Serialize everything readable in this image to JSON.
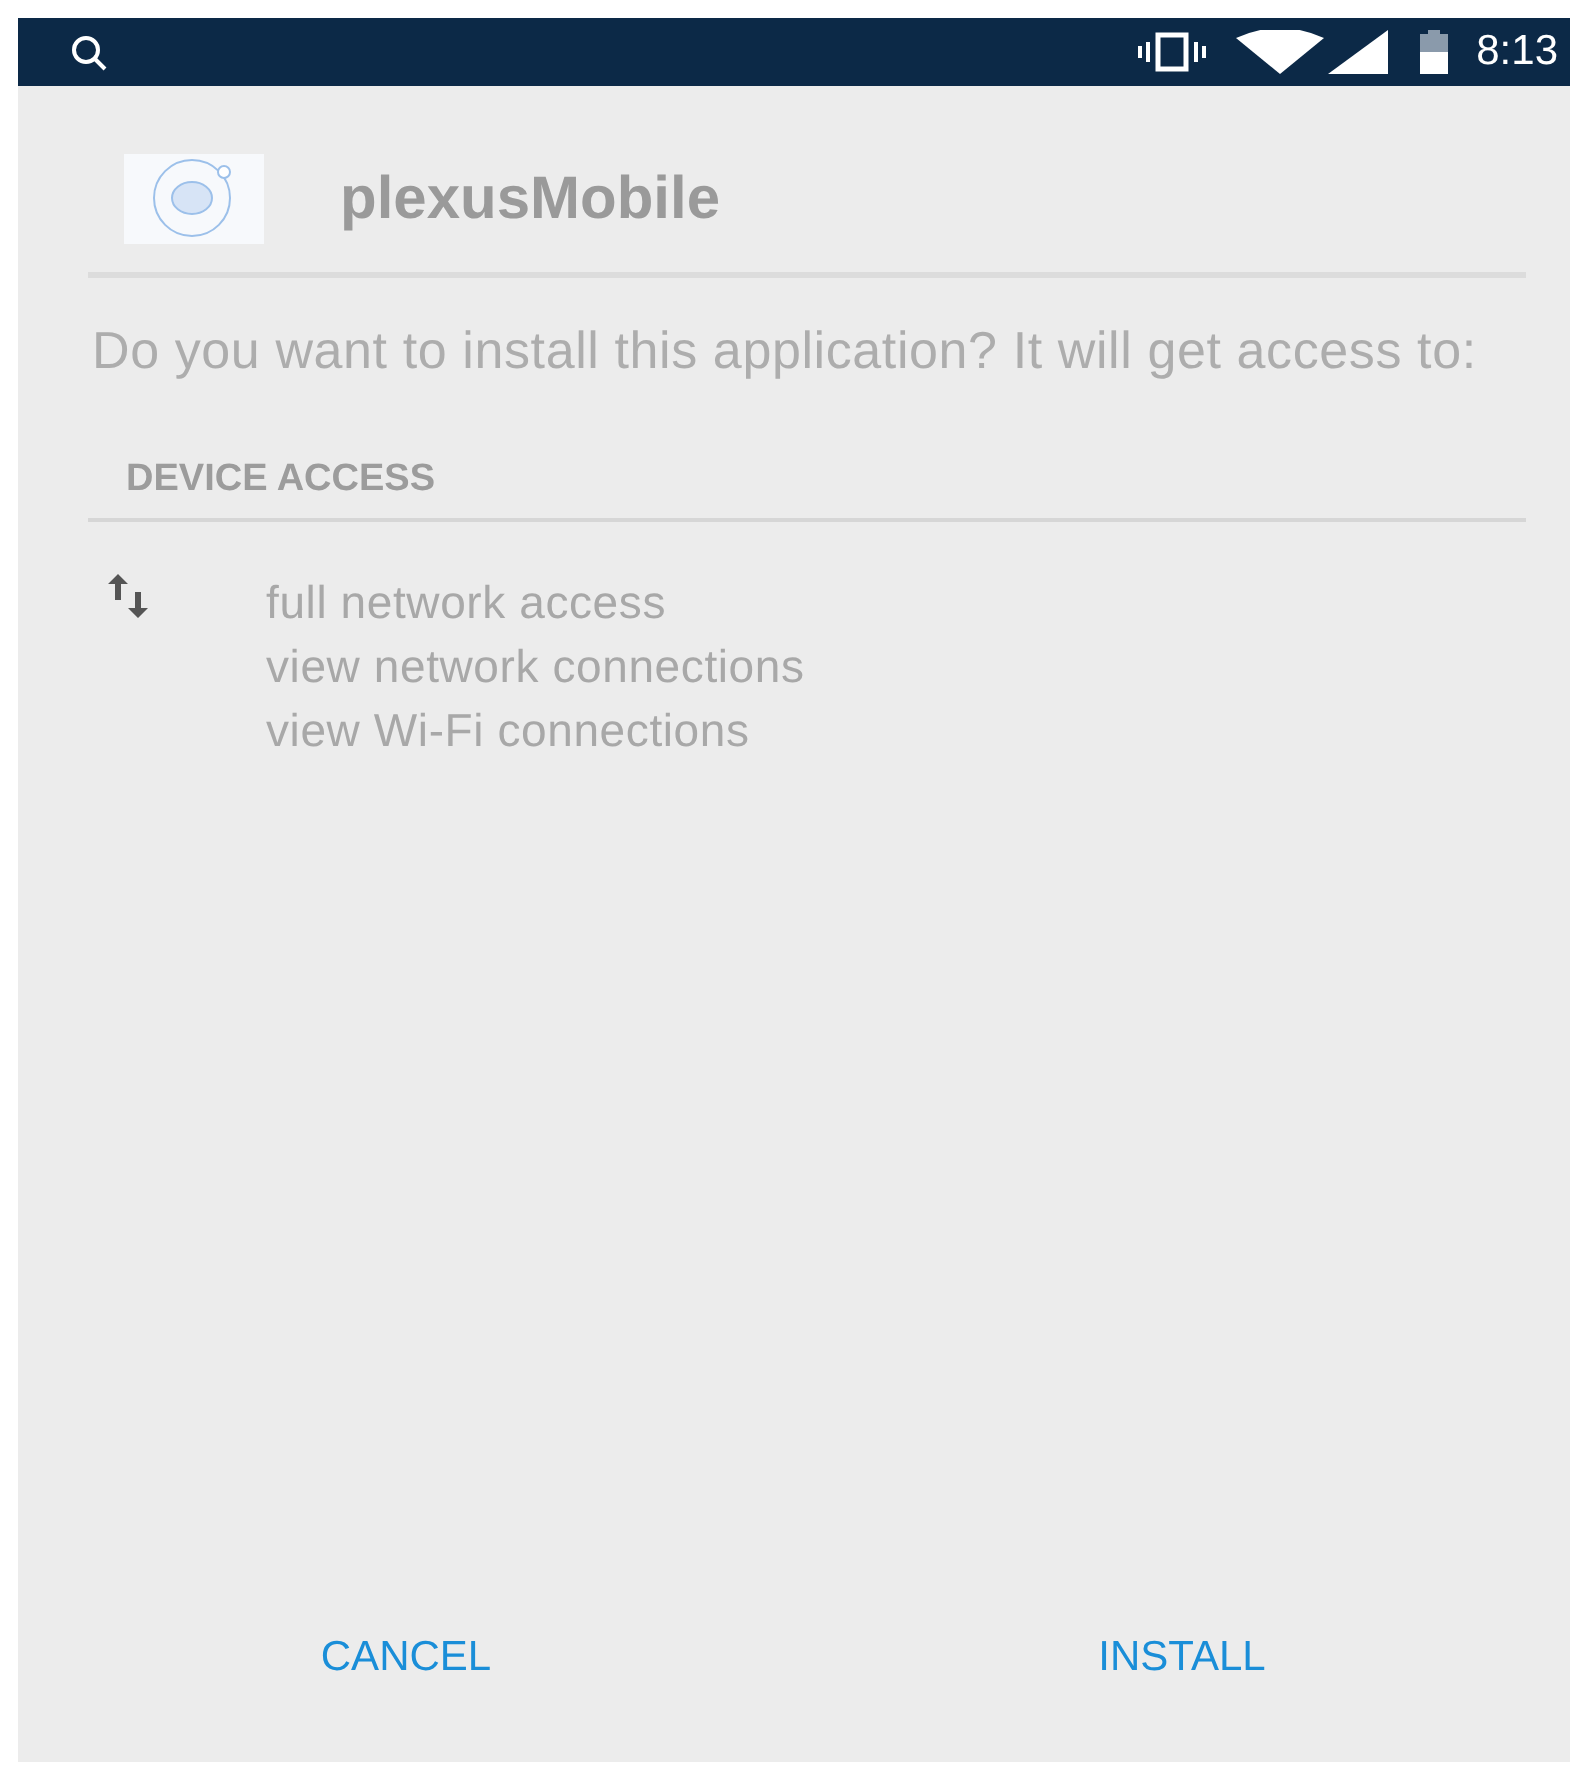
{
  "status_bar": {
    "time": "8:13"
  },
  "app": {
    "name": "plexusMobile"
  },
  "prompt": "Do you want to install this application? It will get access to:",
  "section": {
    "title": "DEVICE ACCESS",
    "permission_groups": [
      {
        "items": [
          "full network access",
          "view network connections",
          "view Wi-Fi connections"
        ]
      }
    ]
  },
  "buttons": [
    {
      "label": "CANCEL"
    },
    {
      "label": "INSTALL"
    }
  ]
}
